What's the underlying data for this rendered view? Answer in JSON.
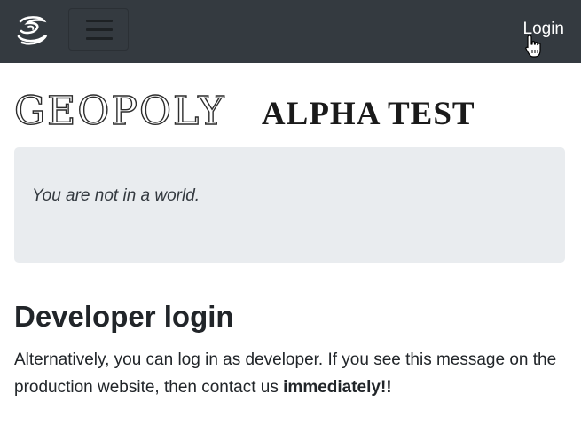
{
  "navbar": {
    "login_label": "Login",
    "logo_icon": "geopoly-logo-icon",
    "menu_icon": "hamburger-menu-icon",
    "background": "#343a40"
  },
  "heading": {
    "brand": "GEOPOLY",
    "subtitle": "ALPHA TEST"
  },
  "world_status": {
    "message": "You are not in a world."
  },
  "developer": {
    "title": "Developer login",
    "text": "Alternatively, you can log in as developer. If you see this message on the production website, then contact us ",
    "emphasis": "immediately!!"
  }
}
